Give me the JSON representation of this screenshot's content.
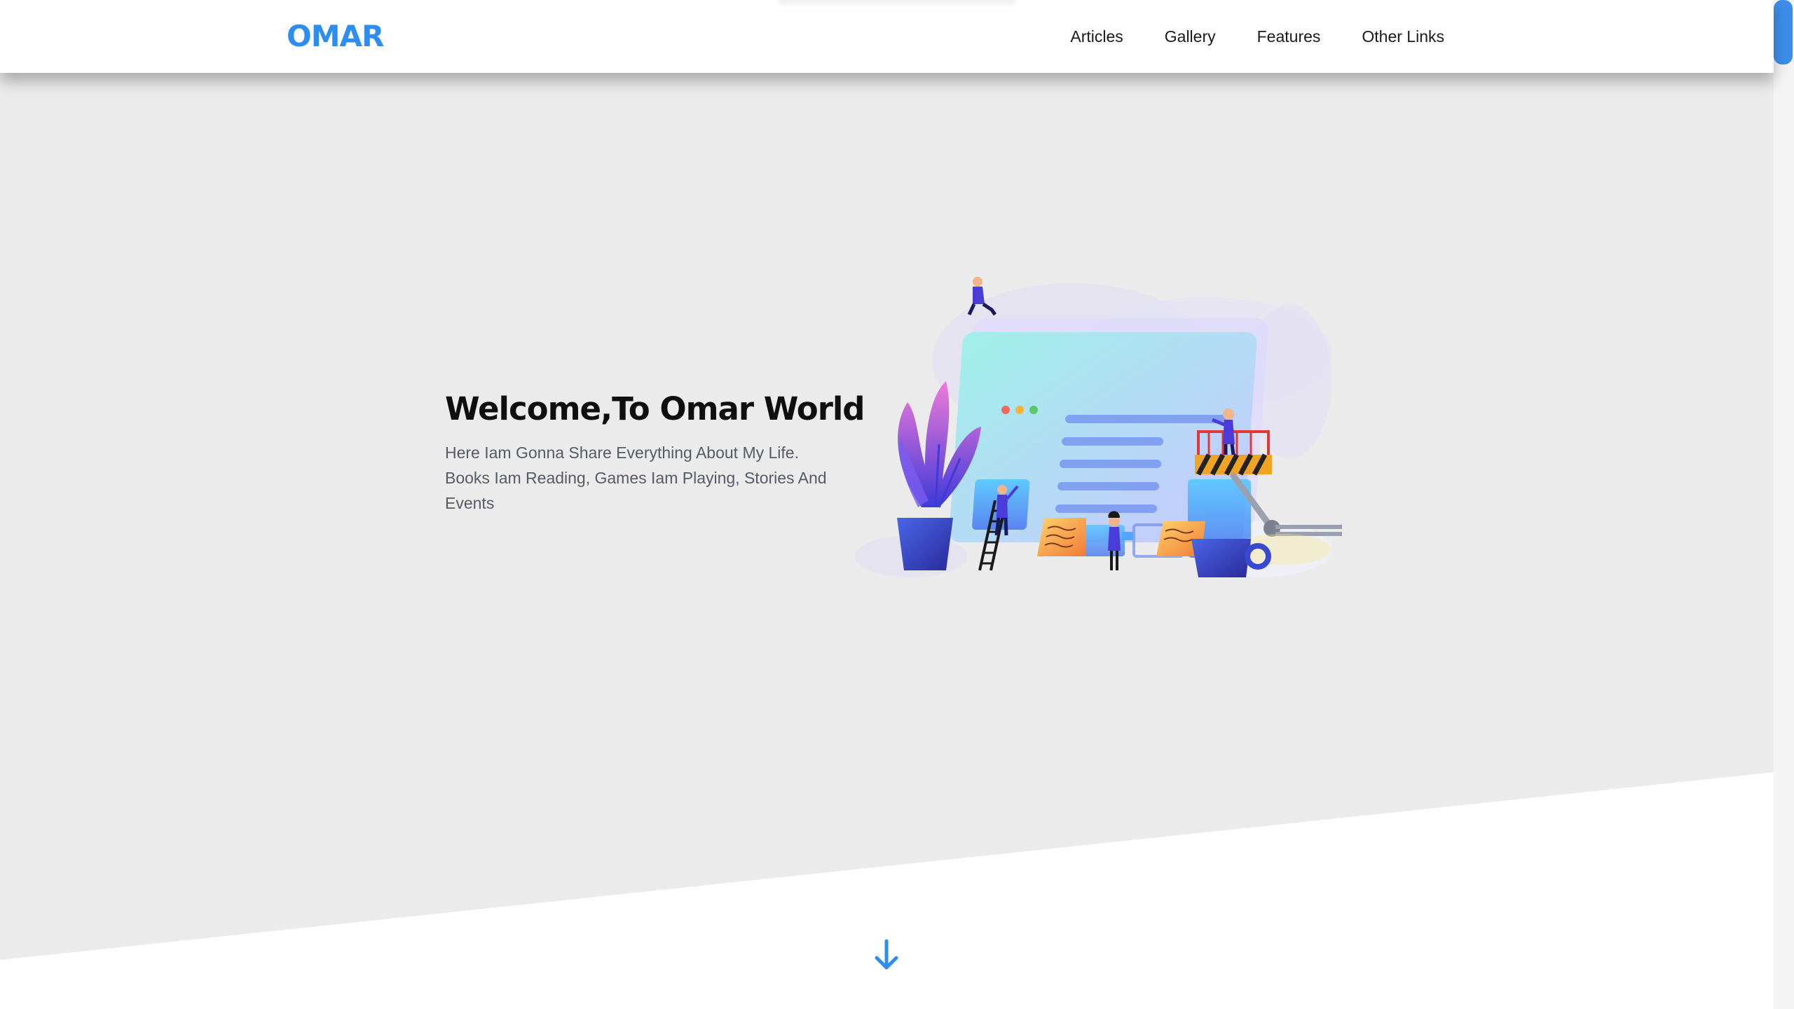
{
  "header": {
    "logo": "OMAR",
    "nav": [
      "Articles",
      "Gallery",
      "Features",
      "Other Links"
    ]
  },
  "landing": {
    "title": "Welcome,To Omar World",
    "text": "Here Iam Gonna Share Everything About My Life. Books Iam Reading, Games Iam Playing, Stories And Events"
  },
  "colors": {
    "accent": "#2d8ef0",
    "landing_bg": "#ebebeb",
    "scroll_thumb": "#3c8eea"
  },
  "icons": {
    "go_down": "arrow-down-icon"
  }
}
